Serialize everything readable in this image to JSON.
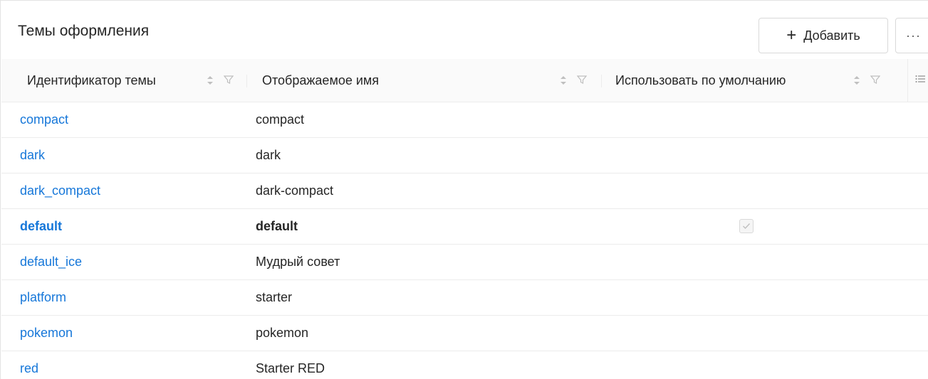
{
  "page": {
    "title": "Темы оформления"
  },
  "toolbar": {
    "add_label": "Добавить",
    "add_icon": "+",
    "more_label": "···"
  },
  "table": {
    "columns": [
      {
        "label": "Идентификатор темы"
      },
      {
        "label": "Отображаемое имя"
      },
      {
        "label": "Использовать по умолчанию"
      }
    ],
    "rows": [
      {
        "id": "compact",
        "name": "compact",
        "default": false
      },
      {
        "id": "dark",
        "name": "dark",
        "default": false
      },
      {
        "id": "dark_compact",
        "name": "dark-compact",
        "default": false
      },
      {
        "id": "default",
        "name": "default",
        "default": true
      },
      {
        "id": "default_ice",
        "name": "Мудрый совет",
        "default": false
      },
      {
        "id": "platform",
        "name": "starter",
        "default": false
      },
      {
        "id": "pokemon",
        "name": "pokemon",
        "default": false
      },
      {
        "id": "red",
        "name": "Starter RED",
        "default": false
      }
    ]
  },
  "colors": {
    "link": "#1677d9",
    "text": "#262626",
    "header_bg": "#fafafa",
    "border": "#ececec"
  }
}
